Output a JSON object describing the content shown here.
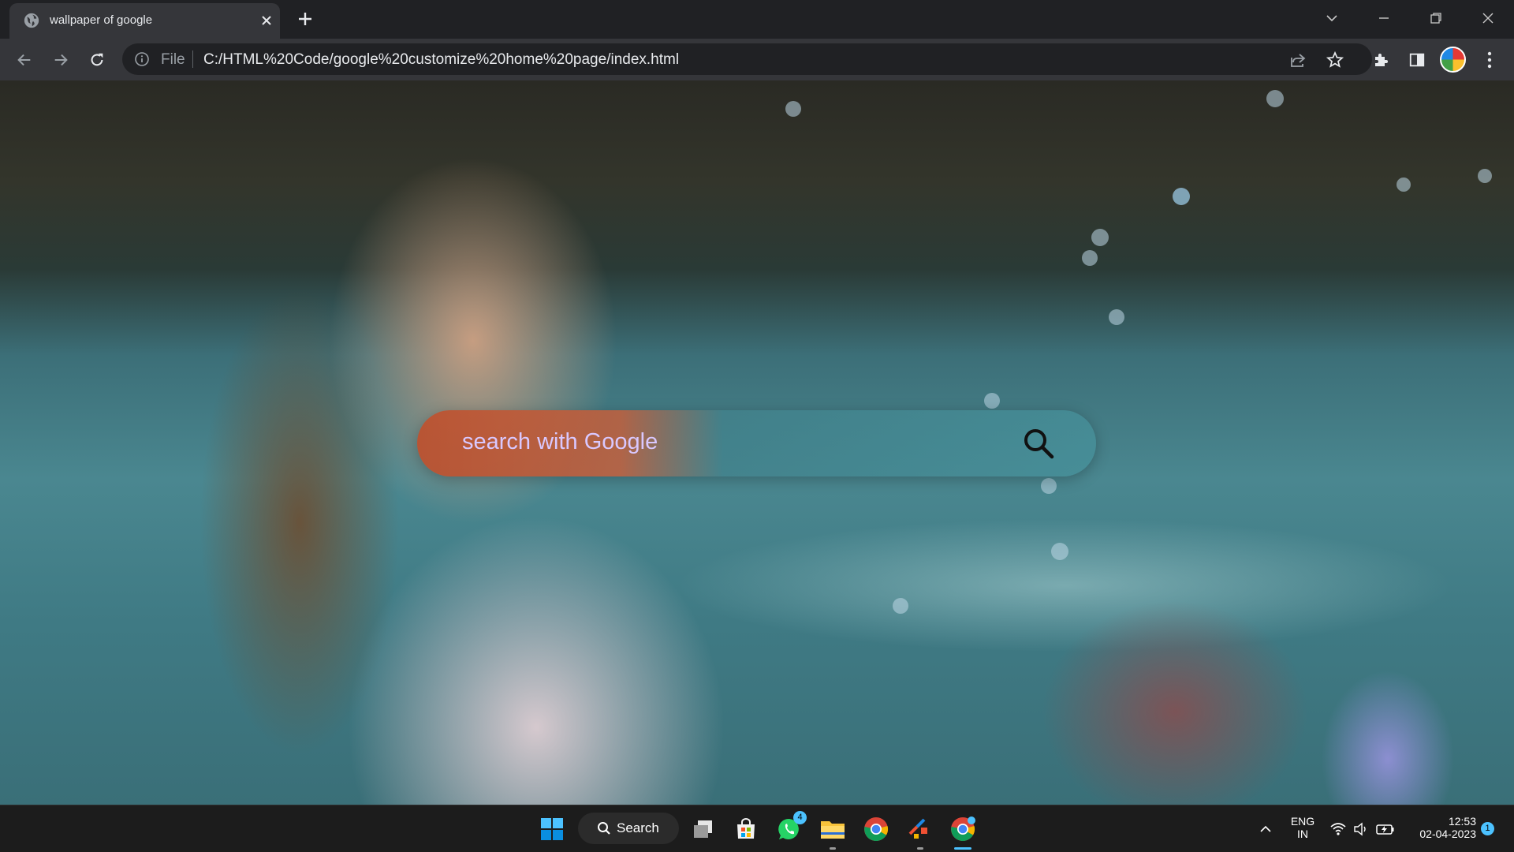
{
  "browser": {
    "tab": {
      "title": "wallpaper of google",
      "favicon": "globe-icon"
    },
    "address_bar": {
      "scheme_label": "File",
      "url": "C:/HTML%20Code/google%20customize%20home%20page/index.html"
    },
    "icons": [
      "back-arrow-icon",
      "forward-arrow-icon",
      "reload-icon",
      "info-icon",
      "share-icon",
      "star-icon",
      "extensions-puzzle-icon",
      "side-panel-icon",
      "profile-avatar",
      "kebab-menu-icon",
      "tab-search-chevron-icon",
      "minimize-icon",
      "restore-icon",
      "close-icon"
    ]
  },
  "page": {
    "search": {
      "placeholder": "search with Google",
      "icon": "magnifier-icon"
    },
    "accent_colors": {
      "search_left": "#be502d",
      "search_right": "#46919b",
      "placeholder": "#d9c8ff"
    }
  },
  "taskbar": {
    "search_label": "Search",
    "apps": [
      "windows-start-icon",
      "task-view-icon",
      "microsoft-store-icon",
      "whatsapp-icon",
      "file-explorer-icon",
      "chrome-icon",
      "git-icon",
      "chrome-dev-icon"
    ],
    "whatsapp_badge": "4",
    "language": {
      "line1": "ENG",
      "line2": "IN"
    },
    "clock": {
      "time": "12:53",
      "date": "02-04-2023"
    },
    "notification_count": "1"
  }
}
